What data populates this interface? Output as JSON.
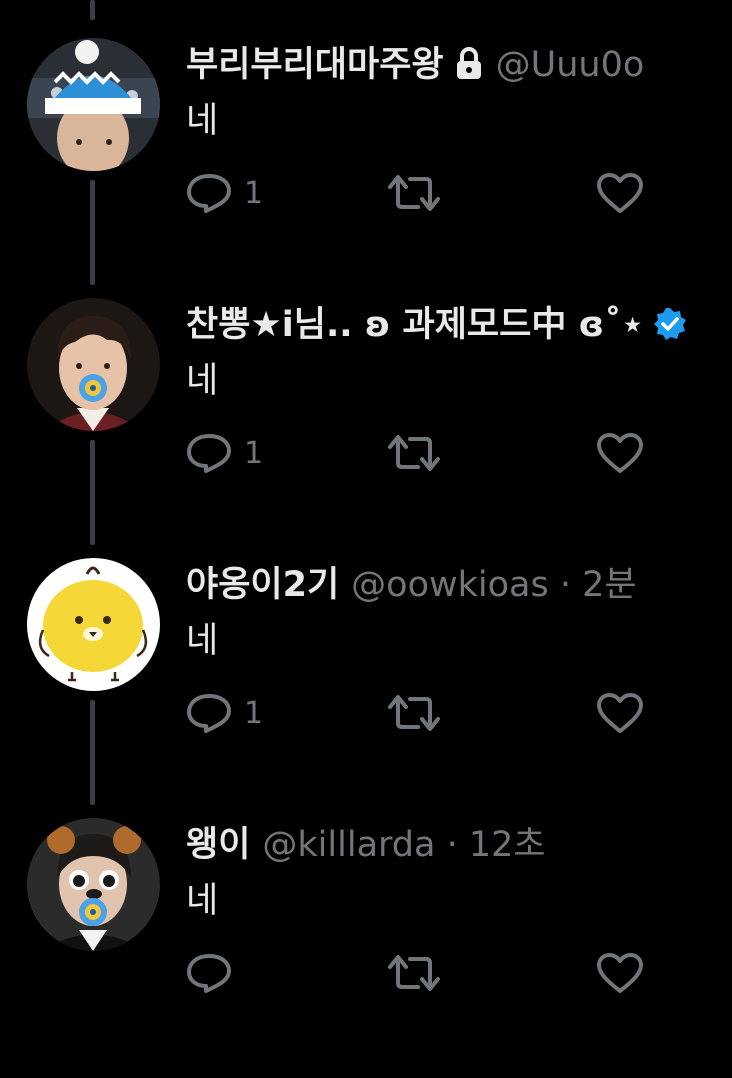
{
  "tweets": [
    {
      "display_name": "부리부리대마주왕",
      "handle": "@Uuu0o",
      "time": "",
      "text": "네",
      "reply_count": "1",
      "icons": [
        "lock-icon"
      ]
    },
    {
      "display_name": "찬뽕★i님.. ʚ 과제모드中 ɞ˚⋆",
      "handle": "",
      "time": "",
      "text": "네",
      "reply_count": "1",
      "icons": [
        "verified-badge-icon"
      ]
    },
    {
      "display_name": "야옹이2기",
      "handle": "@oowkioas",
      "time": "· 2분",
      "text": "네",
      "reply_count": "1",
      "icons": []
    },
    {
      "display_name": "왱이",
      "handle": "@killlarda",
      "time": "· 12초",
      "text": "네",
      "reply_count": "",
      "icons": []
    }
  ],
  "colors": {
    "background": "#000000",
    "primary_text": "#e7e9ea",
    "secondary_text": "#71767b",
    "thread_line": "#3a3d41",
    "verified_blue": "#1d9bf0"
  }
}
